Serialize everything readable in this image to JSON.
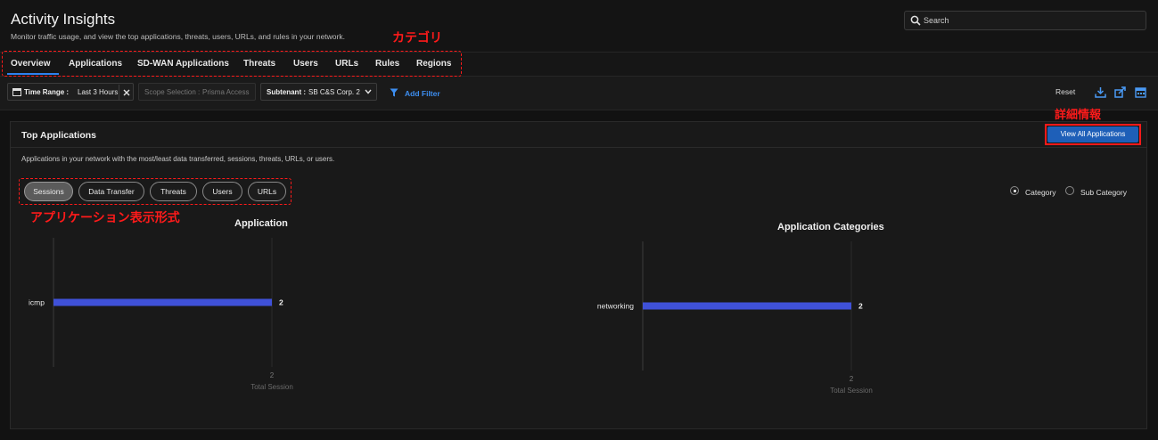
{
  "header": {
    "title": "Activity Insights",
    "subtitle": "Monitor traffic usage, and view the top applications, threats, users, URLs, and rules in your network.",
    "search_placeholder": "Search"
  },
  "annotations": {
    "category": "カテゴリ",
    "details": "詳細情報",
    "app_display": "アプリケーション表示形式"
  },
  "tabs": [
    "Overview",
    "Applications",
    "SD-WAN Applications",
    "Threats",
    "Users",
    "URLs",
    "Rules",
    "Regions"
  ],
  "filters": {
    "time_range_label": "Time Range :",
    "time_range_value": "Last 3 Hours",
    "scope_label": "Scope Selection :",
    "scope_value": "Prisma Access",
    "subtenant_label": "Subtenant :",
    "subtenant_value": "SB C&S Corp. 2",
    "add_filter": "Add Filter",
    "reset": "Reset"
  },
  "panel": {
    "title": "Top Applications",
    "view_all": "View All Applications",
    "description": "Applications in your network with the most/least data transferred, sessions, threats, URLs, or users.",
    "metrics": [
      "Sessions",
      "Data Transfer",
      "Threats",
      "Users",
      "URLs"
    ],
    "active_metric": "Sessions",
    "grouping": {
      "category": "Category",
      "sub_category": "Sub Category",
      "selected": "Category"
    }
  },
  "colors": {
    "bar": "#3f51d8",
    "accent": "#2d82f0",
    "button": "#1e5fb8",
    "annotation": "#ff1a1a"
  },
  "chart_data": [
    {
      "type": "bar",
      "orientation": "horizontal",
      "title": "Application",
      "categories": [
        "icmp"
      ],
      "values": [
        2
      ],
      "data_labels": [
        "2"
      ],
      "x_ticks": [
        "2"
      ],
      "xlabel": "Total Session",
      "xlim": [
        0,
        2
      ]
    },
    {
      "type": "bar",
      "orientation": "horizontal",
      "title": "Application Categories",
      "categories": [
        "networking"
      ],
      "values": [
        2
      ],
      "data_labels": [
        "2"
      ],
      "x_ticks": [
        "2"
      ],
      "xlabel": "Total Session",
      "xlim": [
        0,
        2
      ]
    }
  ]
}
